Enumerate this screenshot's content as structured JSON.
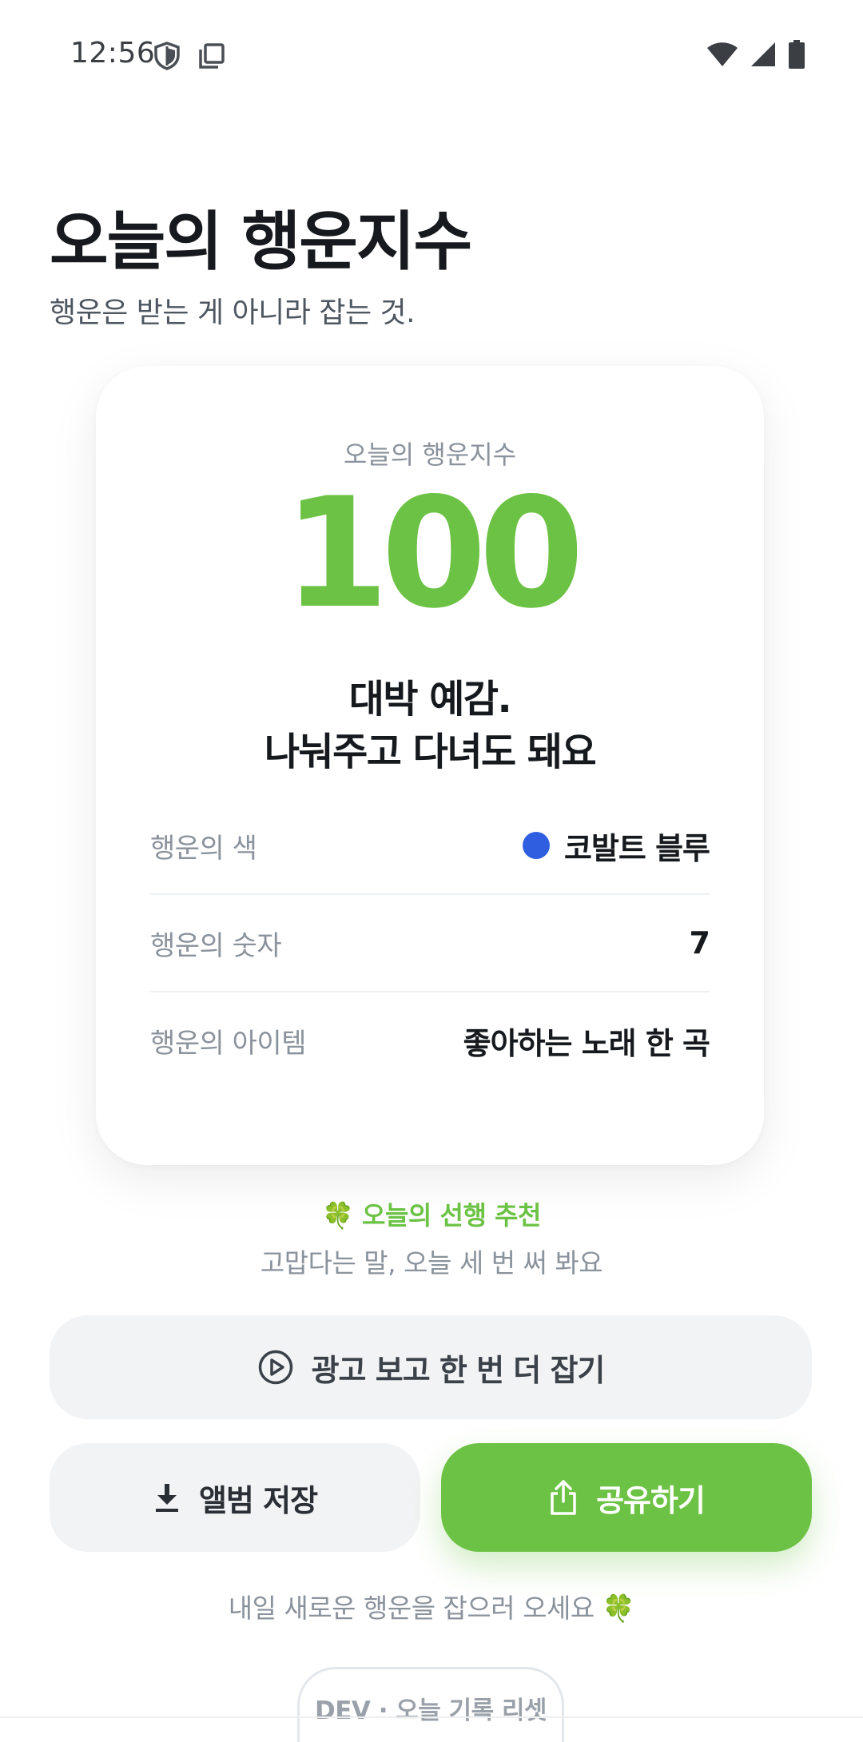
{
  "status_bar": {
    "time": "12:56",
    "left_icons": [
      "shield-icon",
      "copy-icon"
    ],
    "right_icons": [
      "wifi-icon",
      "signal-icon",
      "battery-icon"
    ]
  },
  "header": {
    "title": "오늘의 행운지수",
    "subtitle": "행운은 받는 게 아니라 잡는 것."
  },
  "card": {
    "label": "오늘의 행운지수",
    "score": "100",
    "message_line1": "대박 예감.",
    "message_line2": "나눠주고 다녀도 돼요",
    "rows": [
      {
        "key": "행운의 색",
        "value": "코발트 블루",
        "dot_color": "#2f5fe0"
      },
      {
        "key": "행운의 숫자",
        "value": "7"
      },
      {
        "key": "행운의 아이템",
        "value": "좋아하는 노래 한 곡"
      }
    ]
  },
  "good_deed": {
    "title": "🍀 오늘의 선행 추천",
    "text": "고맙다는 말, 오늘 세 번 써 봐요"
  },
  "buttons": {
    "watch_ad": "광고 보고 한 번 더 잡기",
    "save_album": "앨범 저장",
    "share": "공유하기"
  },
  "footer": {
    "note": "내일 새로운 행운을 잡으러 오세요 🍀",
    "dev_reset": "DEV · 오늘 기록 리셋"
  },
  "colors": {
    "accent": "#6cc244",
    "lucky_color": "#2f5fe0"
  }
}
